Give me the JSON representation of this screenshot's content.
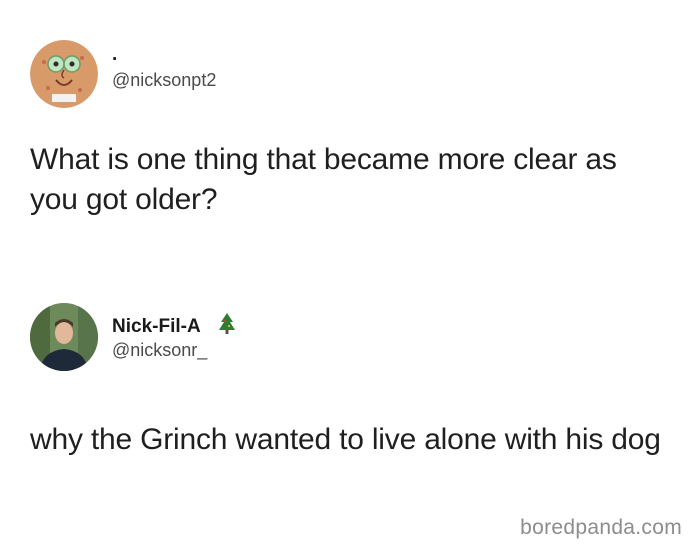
{
  "tweet1": {
    "display_name": ".",
    "handle": "@nicksonpt2",
    "text": "What is one thing that became more clear as you got older?",
    "avatar_icon": "cartoon-face-avatar"
  },
  "tweet2": {
    "display_name": "Nick-Fil-A",
    "name_emoji_icon": "christmas-tree-icon",
    "handle": "@nicksonr_",
    "text": "why the Grinch wanted to live alone with his dog",
    "avatar_icon": "profile-photo-avatar"
  },
  "watermark": "boredpanda.com",
  "colors": {
    "background": "#ffffff",
    "text": "#1f1f1f",
    "handle": "#4a4a4a",
    "watermark": "#8c8c8c"
  }
}
